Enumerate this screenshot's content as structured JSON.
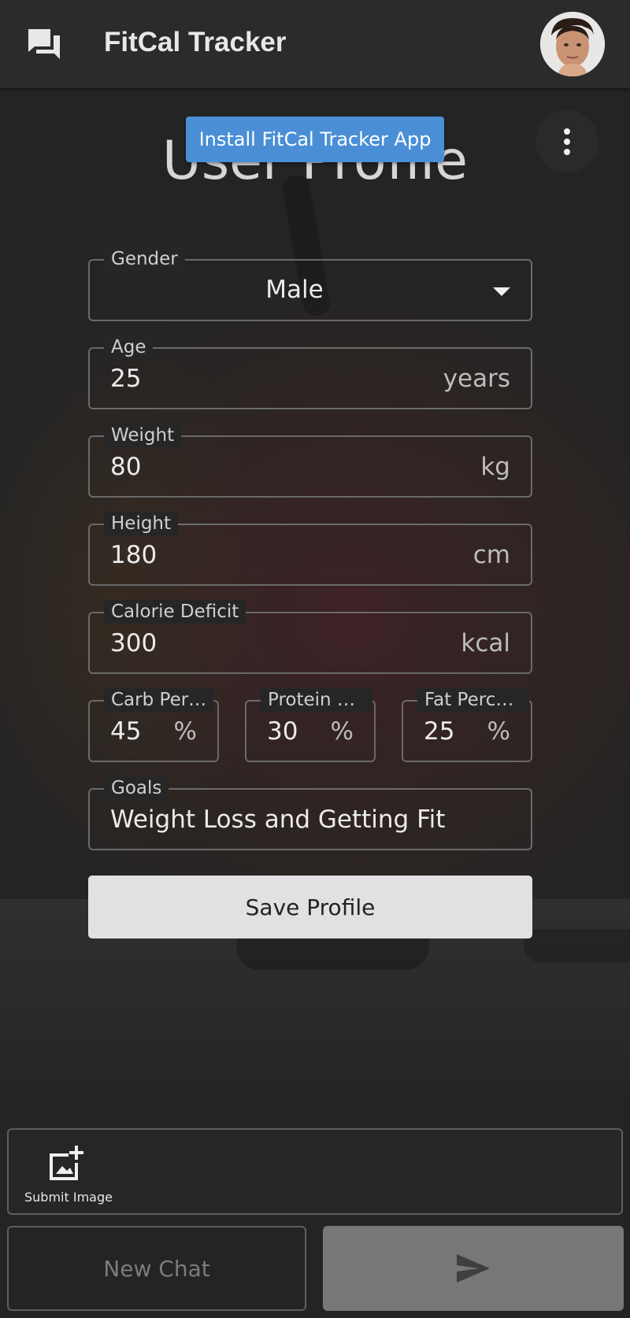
{
  "header": {
    "title": "FitCal Tracker"
  },
  "page": {
    "title": "User Profile",
    "install_label": "Install FitCal Tracker App"
  },
  "form": {
    "gender": {
      "label": "Gender",
      "value": "Male"
    },
    "age": {
      "label": "Age",
      "value": "25",
      "unit": "years"
    },
    "weight": {
      "label": "Weight",
      "value": "80",
      "unit": "kg"
    },
    "height": {
      "label": "Height",
      "value": "180",
      "unit": "cm"
    },
    "deficit": {
      "label": "Calorie Deficit",
      "value": "300",
      "unit": "kcal"
    },
    "carb": {
      "label": "Carb Per…",
      "value": "45",
      "unit": "%"
    },
    "protein": {
      "label": "Protein P…",
      "value": "30",
      "unit": "%"
    },
    "fat": {
      "label": "Fat Perce…",
      "value": "25",
      "unit": "%"
    },
    "goals": {
      "label": "Goals",
      "value": "Weight Loss and Getting Fit"
    },
    "save_label": "Save Profile"
  },
  "chat": {
    "submit_image_label": "Submit Image",
    "new_chat_label": "New Chat"
  },
  "icons": [
    "chat-bubbles-icon",
    "more-vert-icon",
    "dropdown-arrow-icon",
    "add-photo-icon",
    "send-icon"
  ],
  "colors": {
    "accent": "#4a8fd6",
    "background": "#242424",
    "appbar": "#2b2b2b",
    "save_button": "#e2e0e2",
    "send_button": "#777777"
  }
}
